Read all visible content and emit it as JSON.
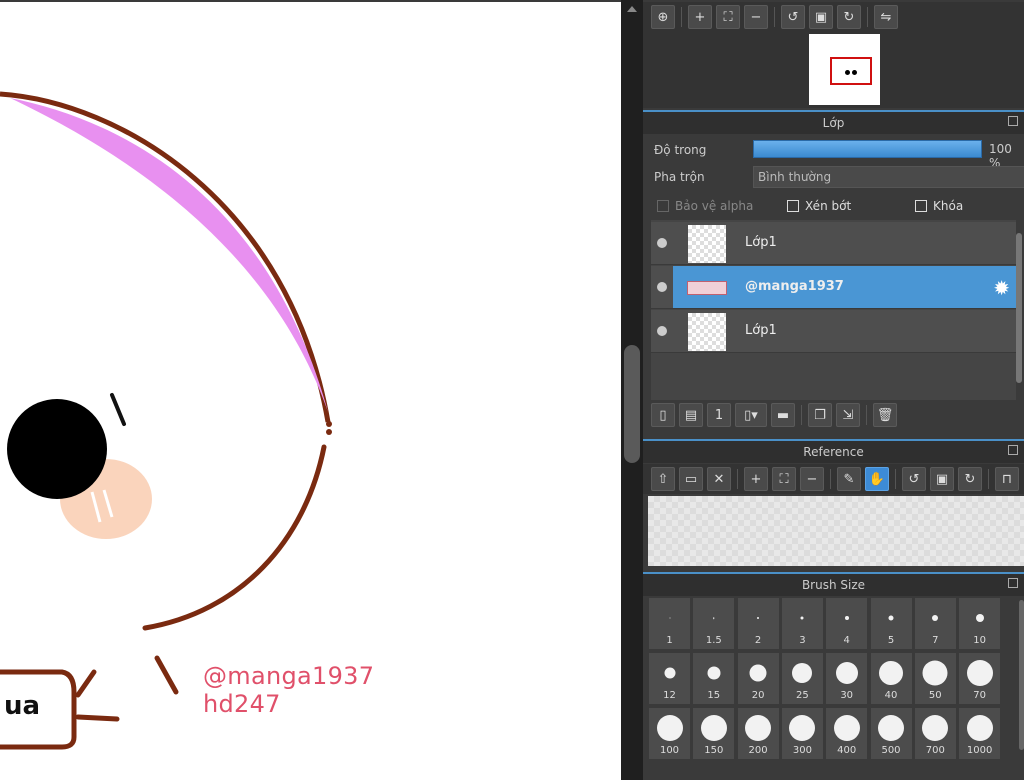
{
  "canvas": {
    "watermark_line1": "@manga1937",
    "watermark_line2": "hd247",
    "sign_text": "ua"
  },
  "navigator": {
    "tools": [
      "zoom-fit-icon",
      "zoom-in-icon",
      "fit-window-icon",
      "zoom-out-icon",
      "rotate-left-icon",
      "reset-rotation-icon",
      "rotate-right-icon",
      "flip-icon"
    ]
  },
  "layer_panel": {
    "title": "Lớp",
    "opacity_label": "Độ trong",
    "opacity_value": "100 %",
    "opacity_fraction": 1.0,
    "blend_label": "Pha trộn",
    "blend_value": "Bình thường",
    "protect_alpha_label": "Bảo vệ alpha",
    "clipping_label": "Xén bớt",
    "lock_label": "Khóa",
    "layers": [
      {
        "name": "Lớp1",
        "selected": false
      },
      {
        "name": "@manga1937",
        "selected": true
      },
      {
        "name": "Lớp1",
        "selected": false
      }
    ]
  },
  "reference_panel": {
    "title": "Reference"
  },
  "brush_panel": {
    "title": "Brush Size",
    "sizes": [
      "1",
      "1.5",
      "2",
      "3",
      "4",
      "5",
      "7",
      "10",
      "12",
      "15",
      "20",
      "25",
      "30",
      "40",
      "50",
      "70",
      "100",
      "150",
      "200",
      "300",
      "400",
      "500",
      "700",
      "1000"
    ]
  },
  "colors": {
    "accent": "#4a96d4",
    "outline": "#7a2a10",
    "pink": "#e890f0",
    "watermark": "#e0506a"
  }
}
